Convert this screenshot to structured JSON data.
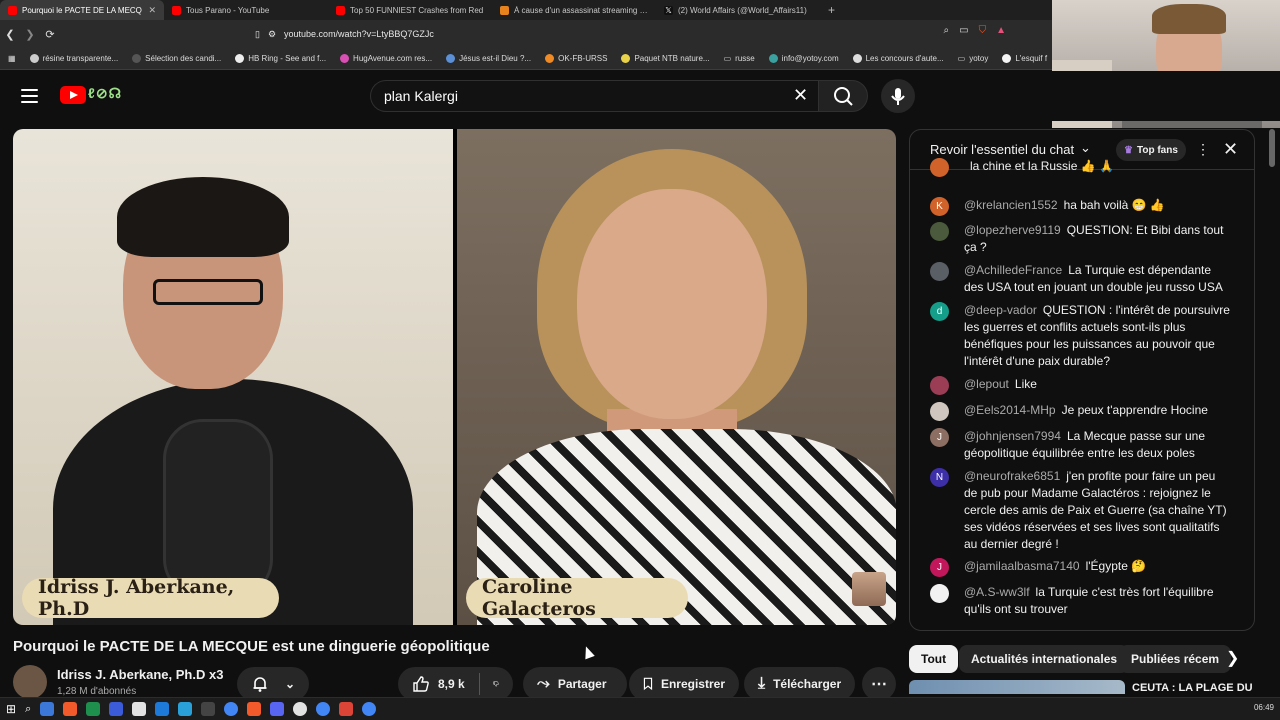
{
  "browser": {
    "tabs": [
      {
        "label": "Pourquoi le PACTE DE LA MECQ",
        "active": true,
        "icon": "youtube-icon"
      },
      {
        "label": "Tous Parano - YouTube",
        "active": false,
        "icon": "youtube-icon"
      },
      {
        "label": "Top 50 FUNNIEST Crashes from Red",
        "active": false,
        "icon": "youtube-icon"
      },
      {
        "label": "À cause d'un assassinat streaming co",
        "active": false,
        "icon": "play-icon"
      },
      {
        "label": "(2) World Affairs (@World_Affairs11)",
        "active": false,
        "icon": "x-icon"
      }
    ],
    "url": "youtube.com/watch?v=LtyBBQ7GZJc",
    "bookmarks": [
      "résine transparente...",
      "Sélection des candi...",
      "HB Ring - See and f...",
      "HugAvenue.com res...",
      "Jésus est-il Dieu ?...",
      "OK-FB-URSS",
      "Paquet NTB nature...",
      "russe",
      "info@yotoy.com",
      "Les concours d'aute...",
      "yotoy",
      "L'esquif f"
    ]
  },
  "youtube": {
    "search": {
      "value": "plan Kalergi"
    },
    "video": {
      "left_name": "Idriss J. Aberkane, Ph.D",
      "right_name": "Caroline Galacteros",
      "title": "Pourquoi le PACTE DE LA MECQUE est une dinguerie géopolitique"
    },
    "channel": {
      "name": "Idriss J. Aberkane, Ph.D x3",
      "subs": "1,28 M d'abonnés"
    },
    "actions": {
      "likes": "8,9 k",
      "share": "Partager",
      "save": "Enregistrer",
      "download": "Télécharger"
    },
    "chat": {
      "title": "Revoir l'essentiel du chat",
      "top_fans": "Top fans",
      "messages": [
        {
          "author": "",
          "text": "la chine et la Russie 👍 🙏",
          "avatar": "",
          "color": "#d1632a"
        },
        {
          "author": "@krelancien1552",
          "text": "ha bah voilà 😁 👍",
          "avatar": "K",
          "color": "#d1632a"
        },
        {
          "author": "@lopezherve9119",
          "text": "QUESTION: Et Bibi dans tout ça ?",
          "avatar": "",
          "color": "#4b5a3c"
        },
        {
          "author": "@AchilledeFrance",
          "text": "La Turquie est dépendante des USA tout en jouant un double jeu russo USA",
          "avatar": "",
          "color": "#5a5f66"
        },
        {
          "author": "@deep-vador",
          "text": "QUESTION : l'intérêt de poursuivre les guerres et conflits actuels sont-ils plus bénéfiques pour les puissances au pouvoir que l'intérêt d'une paix durable?",
          "avatar": "d",
          "color": "#159e8a"
        },
        {
          "author": "@lepout",
          "text": "Like",
          "avatar": "",
          "color": "#9a3d55"
        },
        {
          "author": "@Eels2014-MHp",
          "text": "Je peux t'apprendre Hocine",
          "avatar": "",
          "color": "#cfc6bf"
        },
        {
          "author": "@johnjensen7994",
          "text": "La Mecque passe sur une géopolitique équilibrée entre les deux poles",
          "avatar": "J",
          "color": "#8d6e63"
        },
        {
          "author": "@neurofrake6851",
          "text": "j'en profite pour faire un peu de pub pour Madame Galactéros : rejoignez le cercle des amis de Paix et Guerre (sa chaîne YT) ses vidéos réservées et ses lives sont qualitatifs au dernier degré !",
          "avatar": "N",
          "color": "#3d2fa8"
        },
        {
          "author": "@jamilaalbasma7140",
          "text": "l'Égypte 🤔",
          "avatar": "J",
          "color": "#c2185b"
        },
        {
          "author": "@A.S-ww3lf",
          "text": "la Turquie c'est très fort l'équilibre qu'ils ont su trouver",
          "avatar": "",
          "color": "#f1f1f1"
        }
      ]
    },
    "chips": [
      "Tout",
      "Actualités internationales",
      "Publiées récem"
    ],
    "recommendation": {
      "title": "CEUTA : LA PLAGE DU"
    }
  },
  "taskbar": {
    "time": "06:49"
  }
}
